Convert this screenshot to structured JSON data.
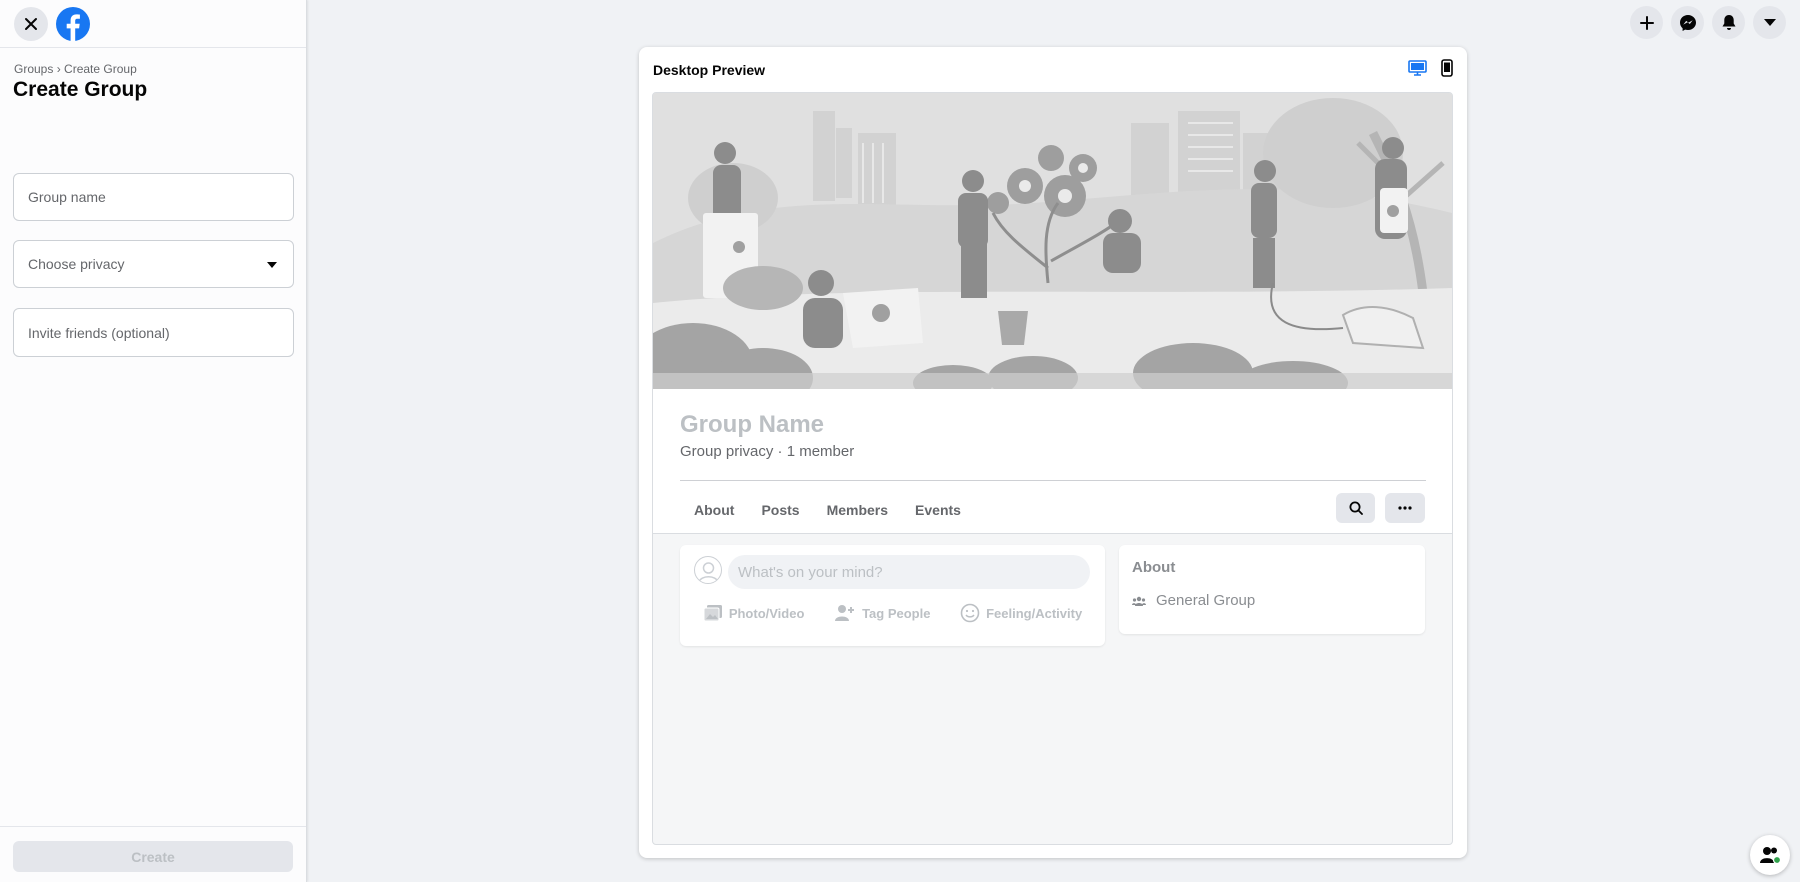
{
  "sidebar": {
    "breadcrumb_groups": "Groups",
    "breadcrumb_sep": "›",
    "breadcrumb_current": "Create Group",
    "title": "Create Group",
    "group_name_placeholder": "Group name",
    "privacy_placeholder": "Choose privacy",
    "invite_placeholder": "Invite friends (optional)",
    "create_label": "Create"
  },
  "preview": {
    "title": "Desktop Preview",
    "group_name": "Group Name",
    "group_meta": "Group privacy · 1 member",
    "tabs": [
      "About",
      "Posts",
      "Members",
      "Events"
    ],
    "composer_placeholder": "What's on your mind?",
    "actions": [
      "Photo/Video",
      "Tag People",
      "Feeling/Activity"
    ],
    "about_title": "About",
    "about_row": "General Group"
  },
  "colors": {
    "brand": "#1877f2",
    "accent_icon": "#1877f2"
  },
  "icons": [
    "close-icon",
    "facebook-logo-icon",
    "plus-icon",
    "messenger-icon",
    "bell-icon",
    "caret-down-icon",
    "desktop-icon",
    "mobile-icon",
    "search-icon",
    "more-icon",
    "avatar-icon",
    "photo-icon",
    "tag-people-icon",
    "feeling-icon",
    "group-icon",
    "chat-people-icon"
  ]
}
